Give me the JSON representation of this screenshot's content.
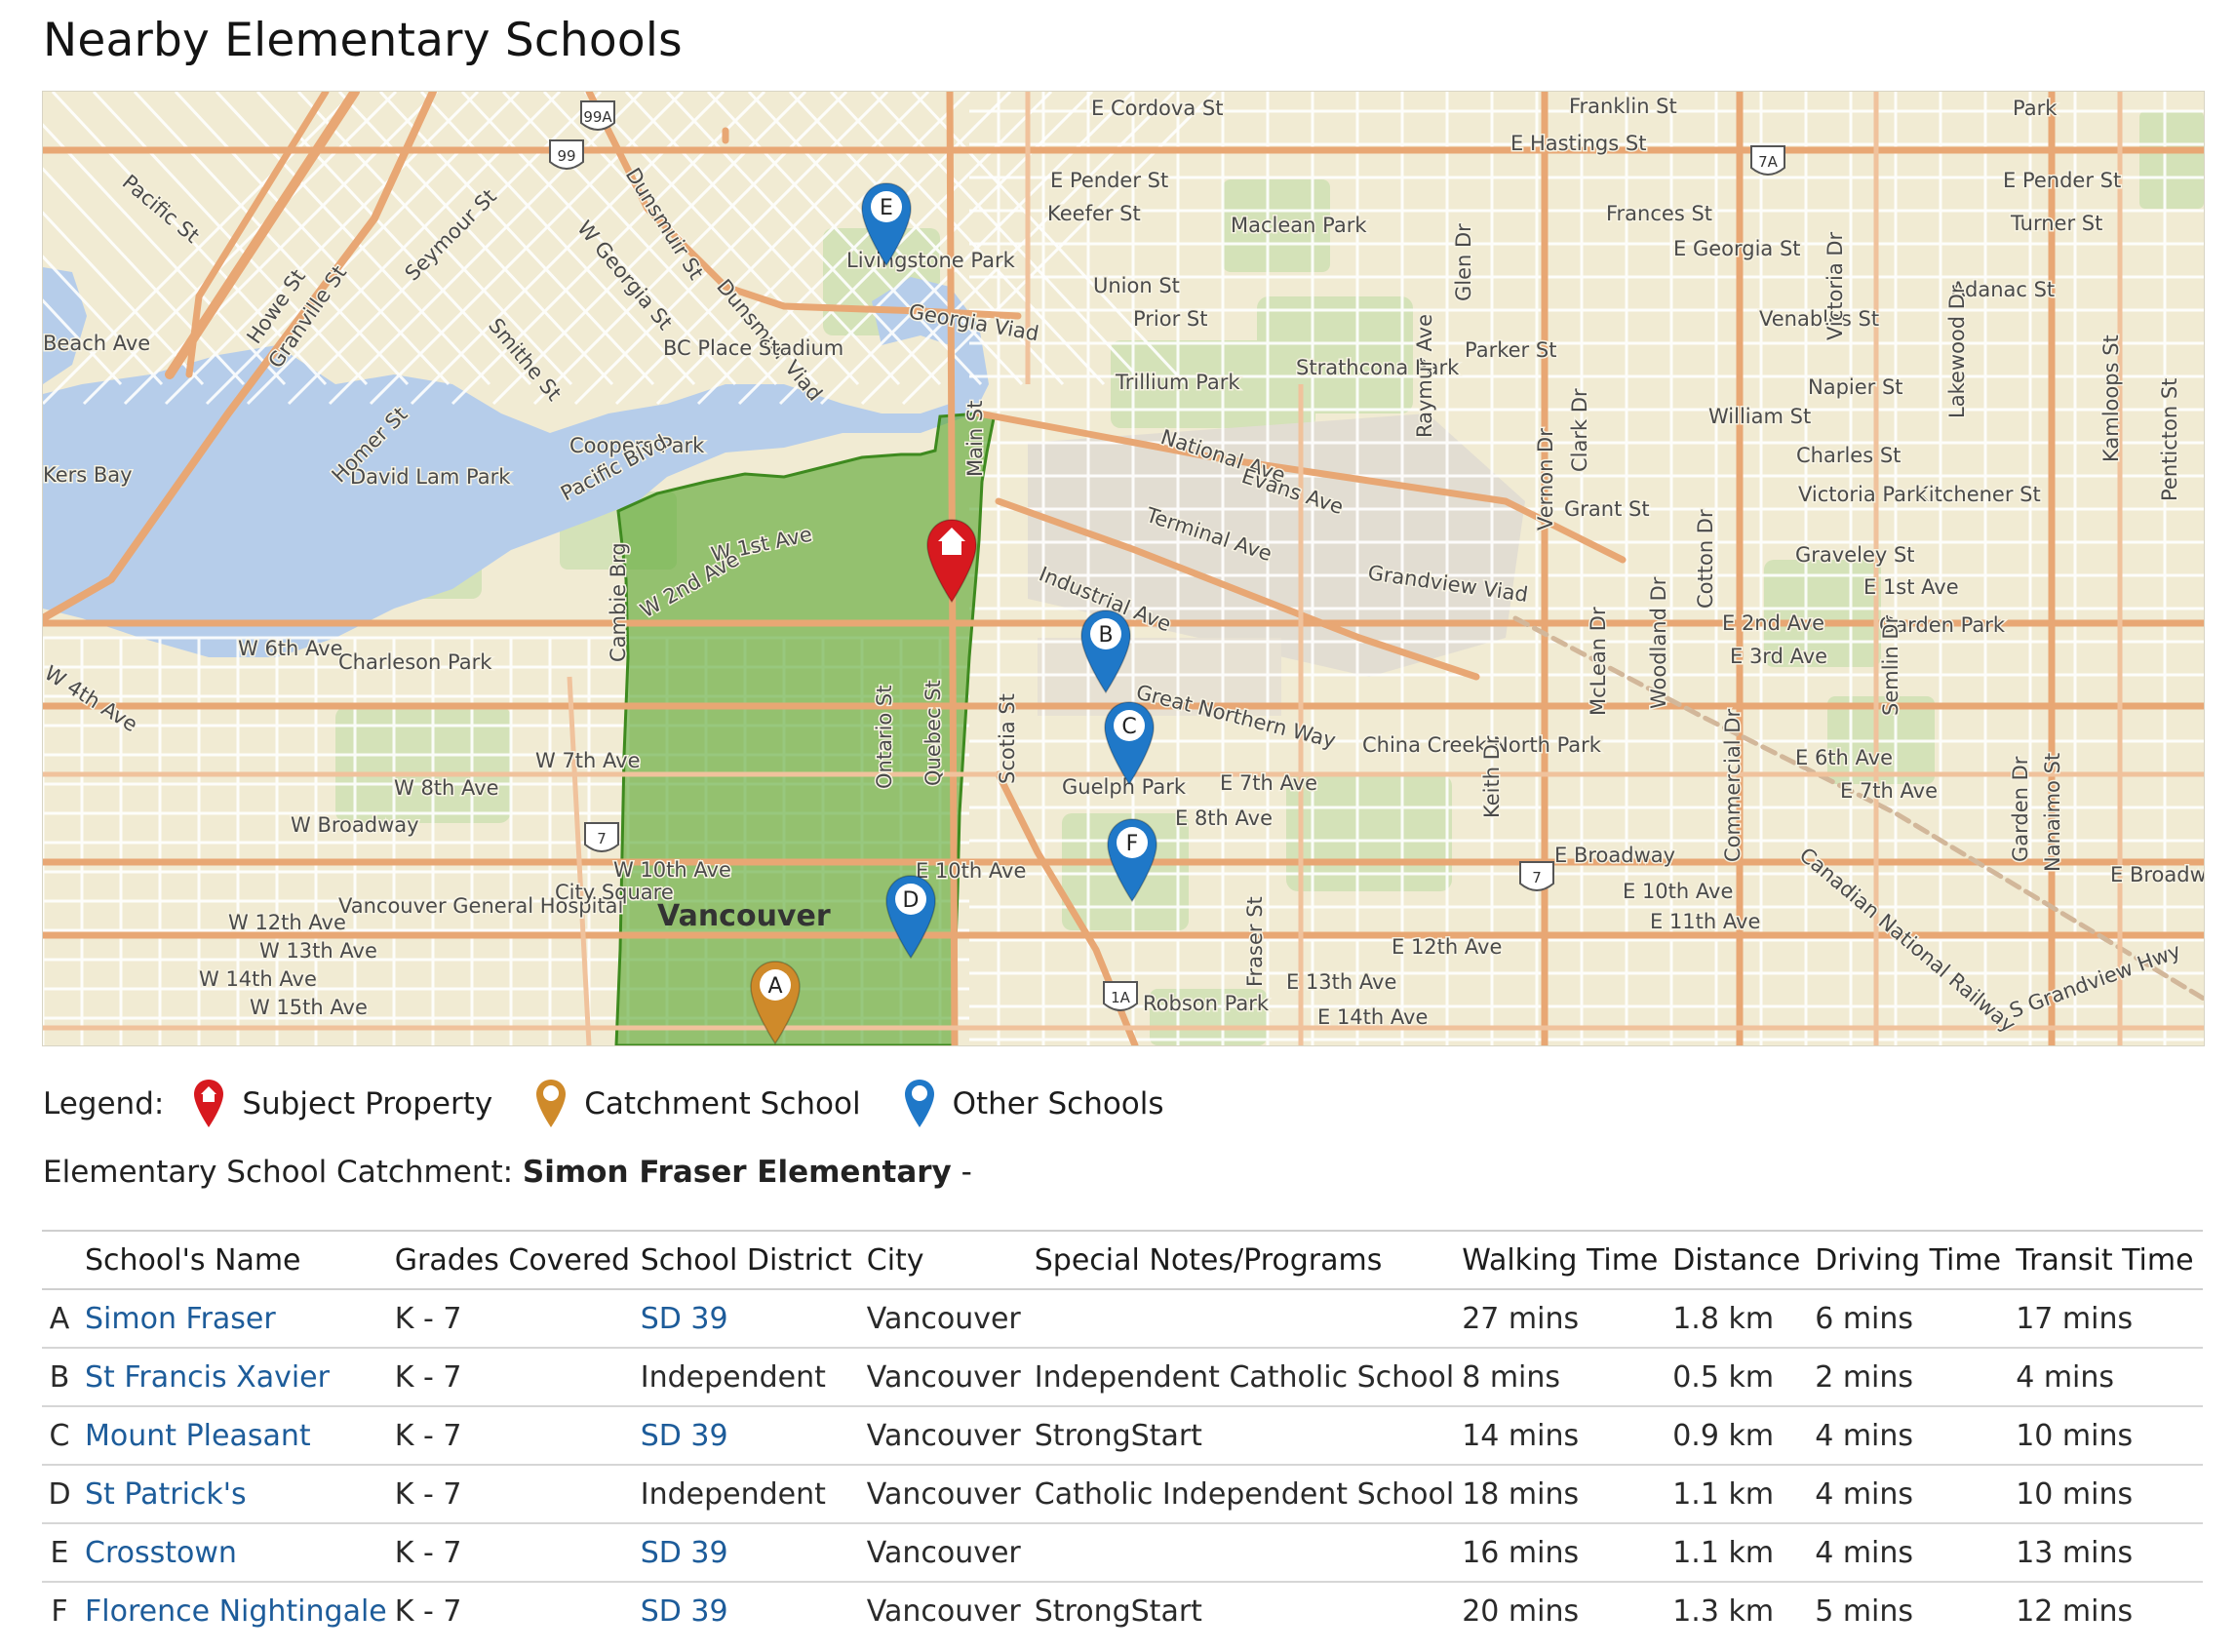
{
  "title": "Nearby Elementary Schools",
  "colors": {
    "subject_marker": "#d7191f",
    "catchment_marker": "#cf8a2a",
    "other_marker": "#1f78c8",
    "catchment_area": "#5aa832",
    "water": "#b6cdea",
    "major_road": "#e8a774",
    "link": "#1d5c9a"
  },
  "map": {
    "city_label": "Vancouver",
    "streets": [
      {
        "name": "E Cordova St"
      },
      {
        "name": "Franklin St"
      },
      {
        "name": "Park"
      },
      {
        "name": "E Hastings St"
      },
      {
        "name": "E Pender St"
      },
      {
        "name": "Keefer St"
      },
      {
        "name": "Maclean Park"
      },
      {
        "name": "Frances St"
      },
      {
        "name": "E Pender St"
      },
      {
        "name": "Turner St"
      },
      {
        "name": "E Georgia St"
      },
      {
        "name": "Union St"
      },
      {
        "name": "Prior St"
      },
      {
        "name": "Georgia Viad"
      },
      {
        "name": "Dunsmuir Viad"
      },
      {
        "name": "Adanac St"
      },
      {
        "name": "Venables St"
      },
      {
        "name": "Parker St"
      },
      {
        "name": "Strathcona Park"
      },
      {
        "name": "Trillium Park"
      },
      {
        "name": "Napier St"
      },
      {
        "name": "William St"
      },
      {
        "name": "Charles St"
      },
      {
        "name": "National Ave"
      },
      {
        "name": "Evans Ave"
      },
      {
        "name": "Terminal Ave"
      },
      {
        "name": "Grant St"
      },
      {
        "name": "Kitchener St"
      },
      {
        "name": "Victoria Park"
      },
      {
        "name": "Graveley St"
      },
      {
        "name": "Grandview Viad"
      },
      {
        "name": "E 1st Ave"
      },
      {
        "name": "Industrial Ave"
      },
      {
        "name": "E 2nd Ave"
      },
      {
        "name": "E 3rd Ave"
      },
      {
        "name": "Garden Park"
      },
      {
        "name": "Great Northern Way"
      },
      {
        "name": "China Creek North Park"
      },
      {
        "name": "E 6th Ave"
      },
      {
        "name": "E 7th Ave"
      },
      {
        "name": "E 7th Ave"
      },
      {
        "name": "E 8th Ave"
      },
      {
        "name": "Guelph Park"
      },
      {
        "name": "E Broadway"
      },
      {
        "name": "E Broadway"
      },
      {
        "name": "E 10th Ave"
      },
      {
        "name": "E 10th Ave"
      },
      {
        "name": "E 11th Ave"
      },
      {
        "name": "E 12th Ave"
      },
      {
        "name": "E 13th Ave"
      },
      {
        "name": "E 14th Ave"
      },
      {
        "name": "Robson Park"
      },
      {
        "name": "Canadian National Railway"
      },
      {
        "name": "S Grandview Hwy"
      },
      {
        "name": "W 1st Ave"
      },
      {
        "name": "W 2nd Ave"
      },
      {
        "name": "W 4th Ave"
      },
      {
        "name": "W 6th Ave"
      },
      {
        "name": "W 7th Ave"
      },
      {
        "name": "W 8th Ave"
      },
      {
        "name": "W Broadway"
      },
      {
        "name": "W 10th Ave"
      },
      {
        "name": "W 12th Ave"
      },
      {
        "name": "W 13th Ave"
      },
      {
        "name": "W 14th Ave"
      },
      {
        "name": "W 15th Ave"
      },
      {
        "name": "Charleson Park"
      },
      {
        "name": "David Lam Park"
      },
      {
        "name": "Coopers Park"
      },
      {
        "name": "BC Place Stadium"
      },
      {
        "name": "Pacific Blvd"
      },
      {
        "name": "Howe St"
      },
      {
        "name": "Granville St"
      },
      {
        "name": "Seymour St"
      },
      {
        "name": "Homer St"
      },
      {
        "name": "Smithe St"
      },
      {
        "name": "W Georgia St"
      },
      {
        "name": "Dunsmuir St"
      },
      {
        "name": "Pacific St"
      },
      {
        "name": "Beach Ave"
      },
      {
        "name": "Vancouver General Hospital"
      },
      {
        "name": "City Square"
      },
      {
        "name": "Main St"
      },
      {
        "name": "Scotia St"
      },
      {
        "name": "Ontario St"
      },
      {
        "name": "Quebec St"
      },
      {
        "name": "Cambie Brg"
      },
      {
        "name": "Fraser St"
      },
      {
        "name": "Glen Dr"
      },
      {
        "name": "Raymur Ave"
      },
      {
        "name": "Vernon Dr"
      },
      {
        "name": "Clark Dr"
      },
      {
        "name": "McLean Dr"
      },
      {
        "name": "Woodland Dr"
      },
      {
        "name": "Cotton Dr"
      },
      {
        "name": "Commercial Dr"
      },
      {
        "name": "Semlin Dr"
      },
      {
        "name": "Victoria Dr"
      },
      {
        "name": "Lakewood Dr"
      },
      {
        "name": "Kamloops St"
      },
      {
        "name": "Penticton St"
      },
      {
        "name": "Garden Dr"
      },
      {
        "name": "Nanaimo St"
      },
      {
        "name": "Keith Dr"
      },
      {
        "name": "Livingstone Park"
      },
      {
        "name": "Kers Bay"
      }
    ],
    "route_shields": [
      "99A",
      "99",
      "7A",
      "7",
      "7",
      "1A"
    ],
    "markers": [
      {
        "letter": "E",
        "type": "other"
      },
      {
        "letter": "B",
        "type": "other"
      },
      {
        "letter": "C",
        "type": "other"
      },
      {
        "letter": "D",
        "type": "other"
      },
      {
        "letter": "F",
        "type": "other"
      },
      {
        "letter": "A",
        "type": "catchment"
      },
      {
        "letter": "",
        "type": "subject",
        "icon": "home-icon"
      }
    ]
  },
  "legend": {
    "label": "Legend:",
    "subject": "Subject Property",
    "catchment": "Catchment School",
    "other": "Other Schools"
  },
  "catchment": {
    "label": "Elementary School Catchment:",
    "school": "Simon Fraser Elementary",
    "suffix": "-"
  },
  "table": {
    "headers": [
      "School's Name",
      "Grades Covered",
      "School District",
      "City",
      "Special Notes/Programs",
      "Walking Time",
      "Distance",
      "Driving Time",
      "Transit Time"
    ],
    "rows": [
      {
        "letter": "A",
        "name": "Simon Fraser",
        "grades": "K - 7",
        "district": "SD 39",
        "district_link": true,
        "city": "Vancouver",
        "notes": "",
        "walking": "27 mins",
        "distance": "1.8 km",
        "driving": "6 mins",
        "transit": "17 mins"
      },
      {
        "letter": "B",
        "name": "St Francis Xavier",
        "grades": "K - 7",
        "district": "Independent",
        "district_link": false,
        "city": "Vancouver",
        "notes": "Independent Catholic School",
        "walking": "8 mins",
        "distance": "0.5 km",
        "driving": "2 mins",
        "transit": "4 mins"
      },
      {
        "letter": "C",
        "name": "Mount Pleasant",
        "grades": "K - 7",
        "district": "SD 39",
        "district_link": true,
        "city": "Vancouver",
        "notes": "StrongStart",
        "walking": "14 mins",
        "distance": "0.9 km",
        "driving": "4 mins",
        "transit": "10 mins"
      },
      {
        "letter": "D",
        "name": "St Patrick's",
        "grades": "K - 7",
        "district": "Independent",
        "district_link": false,
        "city": "Vancouver",
        "notes": "Catholic Independent School",
        "walking": "18 mins",
        "distance": "1.1 km",
        "driving": "4 mins",
        "transit": "10 mins"
      },
      {
        "letter": "E",
        "name": "Crosstown",
        "grades": "K - 7",
        "district": "SD 39",
        "district_link": true,
        "city": "Vancouver",
        "notes": "",
        "walking": "16 mins",
        "distance": "1.1 km",
        "driving": "4 mins",
        "transit": "13 mins"
      },
      {
        "letter": "F",
        "name": "Florence Nightingale",
        "grades": "K - 7",
        "district": "SD 39",
        "district_link": true,
        "city": "Vancouver",
        "notes": "StrongStart",
        "walking": "20 mins",
        "distance": "1.3 km",
        "driving": "5 mins",
        "transit": "12 mins"
      }
    ]
  }
}
